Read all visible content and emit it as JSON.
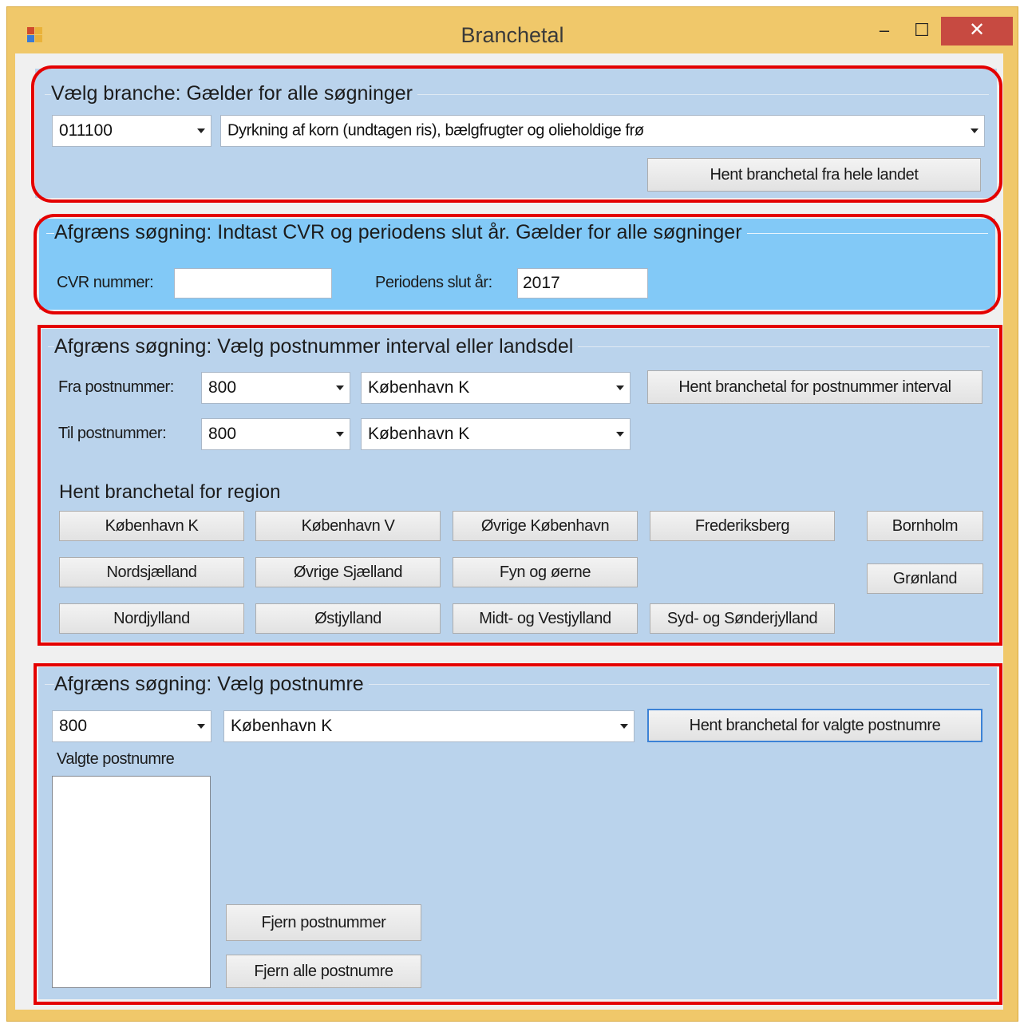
{
  "window": {
    "title": "Branchetal",
    "minimize_symbol": "–",
    "maximize_symbol": "☐",
    "close_symbol": "✕"
  },
  "branche": {
    "group_title": "Vælg branche:  Gælder for alle søgninger",
    "code_value": "011100",
    "description_value": "Dyrkning af korn (undtagen ris), bælgfrugter og olieholdige frø",
    "fetch_all_button": "Hent branchetal fra hele landet"
  },
  "limit_cvr": {
    "group_title": "Afgræns søgning:  Indtast CVR og periodens slut år.  Gælder for alle søgninger",
    "cvr_label": "CVR nummer:",
    "cvr_value": "",
    "period_label": "Periodens slut år:",
    "period_value": "2017"
  },
  "interval": {
    "group_title": "Afgræns søgning:  Vælg postnummer interval eller landsdel",
    "from_label": "Fra postnummer:",
    "from_code": "800",
    "from_city": "København K",
    "to_label": "Til postnummer:",
    "to_code": "800",
    "to_city": "København K",
    "fetch_interval_button": "Hent branchetal for postnummer interval",
    "region_heading": "Hent branchetal for region",
    "regions": {
      "kbh_k": "København K",
      "kbh_v": "København V",
      "ovrige_kbh": "Øvrige København",
      "frederiksberg": "Frederiksberg",
      "bornholm": "Bornholm",
      "nordsjaelland": "Nordsjælland",
      "ovrige_sjaelland": "Øvrige Sjælland",
      "fyn": "Fyn og øerne",
      "gronland": "Grønland",
      "nordjylland": "Nordjylland",
      "ostjylland": "Østjylland",
      "midt_vest": "Midt- og Vestjylland",
      "syd_sonder": "Syd- og Sønderjylland"
    }
  },
  "postnumre": {
    "group_title": "Afgræns søgning:  Vælg postnumre",
    "code_value": "800",
    "city_value": "København K",
    "fetch_selected_button": "Hent branchetal for valgte postnumre",
    "selected_label": "Valgte postnumre",
    "remove_button": "Fjern postnummer",
    "remove_all_button": "Fjern alle postnumre"
  },
  "colors": {
    "highlight": "#e40000",
    "panel_blue": "#bad3ec",
    "panel_cyan": "#82c9f7",
    "close_red": "#c74a41"
  }
}
